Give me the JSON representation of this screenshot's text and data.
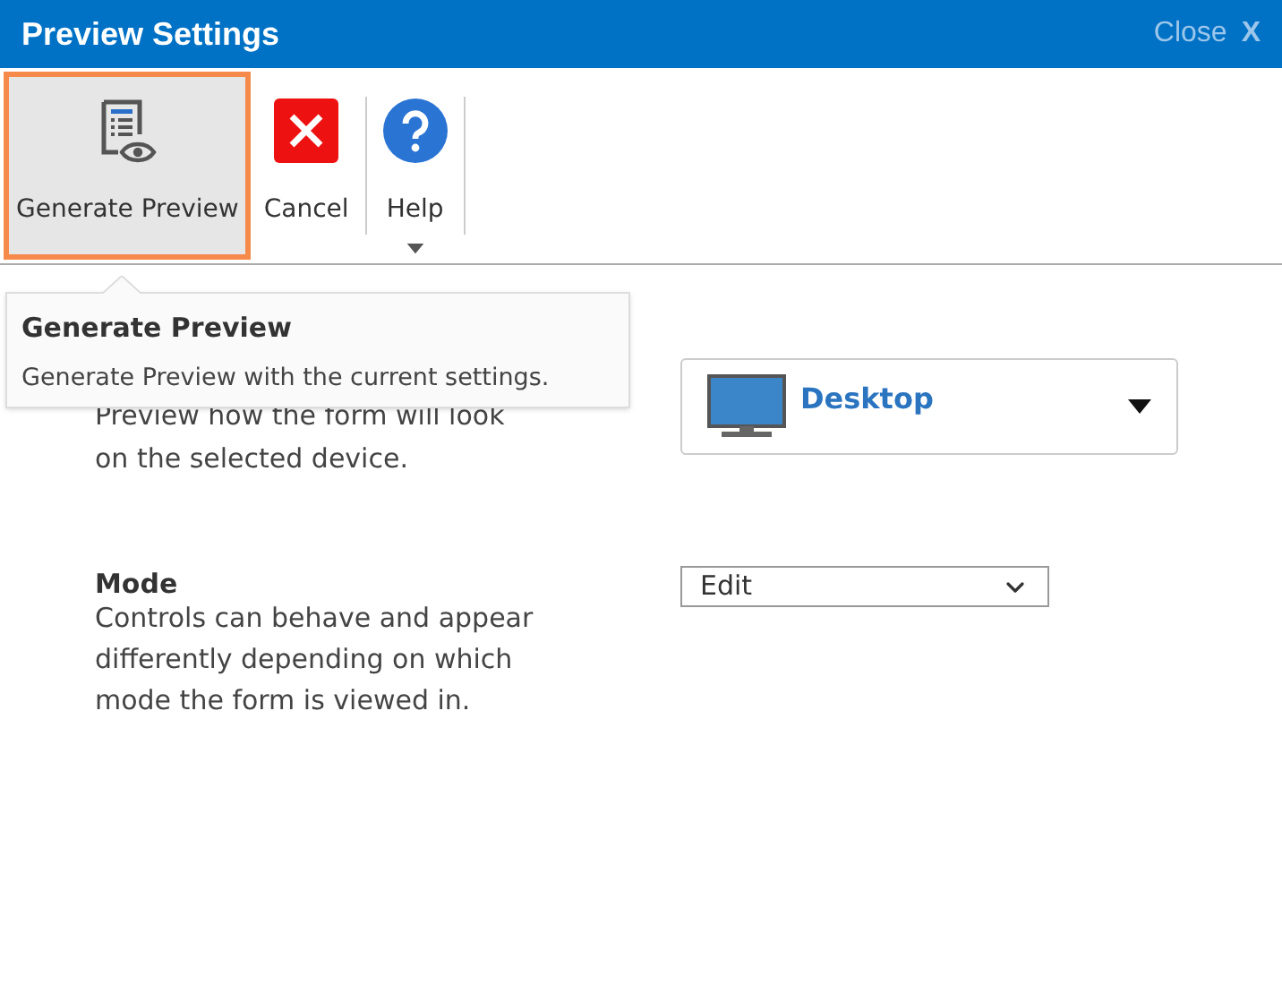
{
  "window": {
    "title": "Preview Settings",
    "close_label": "Close",
    "close_glyph": "X"
  },
  "toolbar": [
    {
      "kind": "generate",
      "label": "Generate Preview",
      "selected": true
    },
    {
      "kind": "cancel",
      "label": "Cancel",
      "selected": false
    },
    {
      "kind": "help",
      "label": "Help",
      "selected": false
    }
  ],
  "tooltip": {
    "title": "Generate Preview",
    "text": "Generate Preview with the current settings."
  },
  "device": {
    "description_lines": [
      "Preview how the form will look",
      "on the selected device."
    ],
    "value": "Desktop"
  },
  "mode": {
    "label": "Mode",
    "description": "Controls can behave and appear differently depending on which mode the form is viewed in.",
    "value": "Edit"
  }
}
